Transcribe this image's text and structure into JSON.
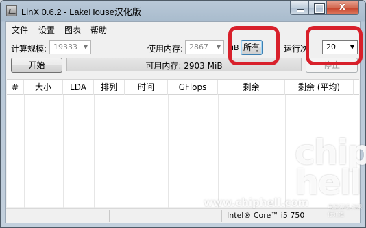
{
  "window": {
    "title": "LinX 0.6.2 - LakeHouse汉化版",
    "close_glyph": "x",
    "controls": [
      "minimize-icon",
      "maximize-icon",
      "close-icon"
    ]
  },
  "menu": {
    "items": [
      "文件",
      "设置",
      "图表",
      "帮助"
    ]
  },
  "params": {
    "problem_size_label": "计算规模:",
    "problem_size_value": "19333",
    "memory_label": "使用内存:",
    "memory_value": "2867",
    "memory_unit_partial": "iB",
    "all_button": "所有",
    "runs_label_partial": "运行次",
    "runs_value": "20"
  },
  "actions": {
    "start_button": "开始",
    "stop_button_partial": "停止",
    "available_memory_text": "可用内存: 2903 MiB",
    "progress_fraction": 0
  },
  "table": {
    "columns": [
      "#",
      "大小",
      "LDA",
      "排列",
      "时间",
      "GFlops",
      "剩余",
      "剩余 (平均)"
    ],
    "rows": []
  },
  "status": {
    "cpu": "Intel® Core™ i5 750"
  },
  "watermark": {
    "logo": "chip hell",
    "url": "www.chiphell.com",
    "small": "电脑领域 如果你知道"
  },
  "colors": {
    "highlight": "#d8202b",
    "progress_fill": "#37c437"
  }
}
